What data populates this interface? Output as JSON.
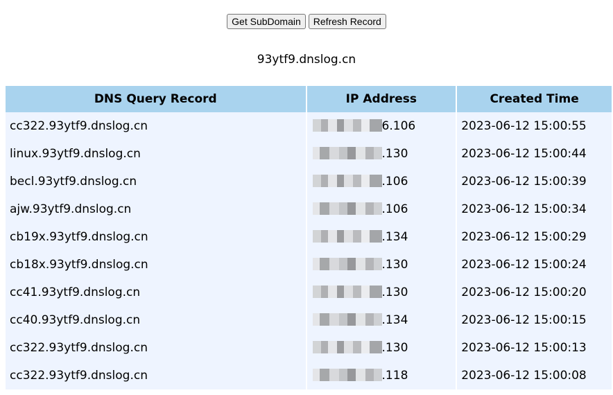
{
  "toolbar": {
    "get_subdomain_label": "Get SubDomain",
    "refresh_record_label": "Refresh Record"
  },
  "subdomain": "93ytf9.dnslog.cn",
  "table": {
    "headers": [
      "DNS Query Record",
      "IP Address",
      "Created Time"
    ],
    "rows": [
      {
        "dns": "cc322.93ytf9.dnslog.cn",
        "ip": "6.106",
        "time": "2023-06-12 15:00:55"
      },
      {
        "dns": "linux.93ytf9.dnslog.cn",
        "ip": ".130",
        "time": "2023-06-12 15:00:44"
      },
      {
        "dns": "becl.93ytf9.dnslog.cn",
        "ip": ".106",
        "time": "2023-06-12 15:00:39"
      },
      {
        "dns": "ajw.93ytf9.dnslog.cn",
        "ip": ".106",
        "time": "2023-06-12 15:00:34"
      },
      {
        "dns": "cb19x.93ytf9.dnslog.cn",
        "ip": ".134",
        "time": "2023-06-12 15:00:29"
      },
      {
        "dns": "cb18x.93ytf9.dnslog.cn",
        "ip": ".130",
        "time": "2023-06-12 15:00:24"
      },
      {
        "dns": "cc41.93ytf9.dnslog.cn",
        "ip": ".130",
        "time": "2023-06-12 15:00:20"
      },
      {
        "dns": "cc40.93ytf9.dnslog.cn",
        "ip": ".134",
        "time": "2023-06-12 15:00:15"
      },
      {
        "dns": "cc322.93ytf9.dnslog.cn",
        "ip": ".130",
        "time": "2023-06-12 15:00:13"
      },
      {
        "dns": "cc322.93ytf9.dnslog.cn",
        "ip": ".118",
        "time": "2023-06-12 15:00:08"
      }
    ]
  }
}
